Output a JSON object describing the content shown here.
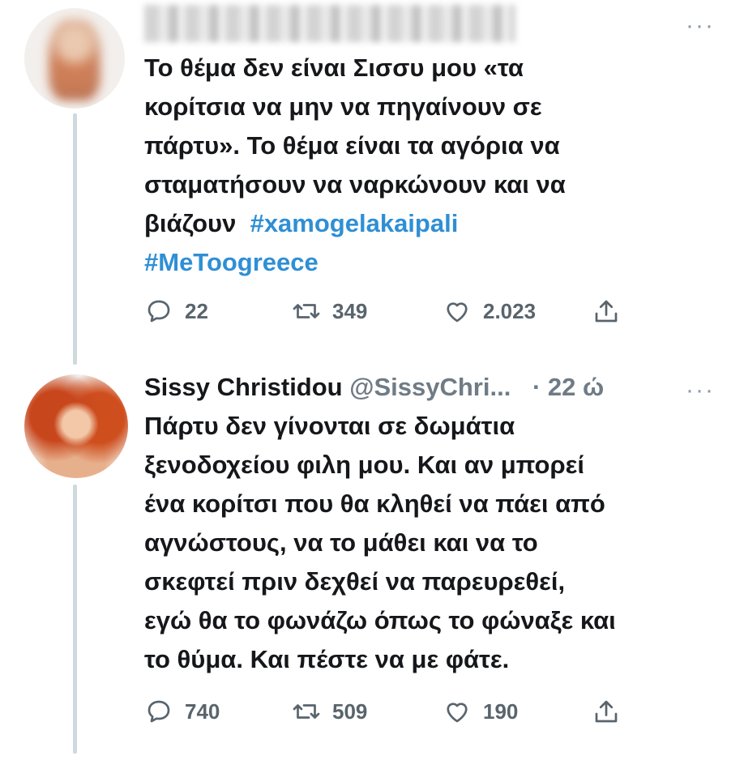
{
  "tweet1": {
    "text_lines": [
      "Το θέμα δεν είναι Σισσυ μου «τα",
      "κορίτσια να μην να πηγαίνουν σε",
      "πάρτυ». Το θέμα είναι τα αγόρια να",
      "σταματήσουν να ναρκώνουν και να",
      "βιάζουν"
    ],
    "hashtag1": "#xamogelakaipali",
    "hashtag2": "#MeToogreece",
    "more_label": "···",
    "replies": "22",
    "retweets": "349",
    "likes": "2.023"
  },
  "tweet2": {
    "display_name": "Sissy Christidou",
    "handle": "@SissyChri...",
    "time": "· 22 ώ",
    "more_label": "···",
    "text_lines": [
      "Πάρτυ δεν γίνονται σε δωμάτια",
      "ξενοδοχείου φιλη μου. Και αν μπορεί",
      "ένα κορίτσι που θα κληθεί να πάει από",
      "αγνώστους, να το μάθει και να το",
      "σκεφτεί πριν δεχθεί να παρευρεθεί,",
      "εγώ θα το φωνάζω όπως το φώναξε και",
      "το θύμα. Και πέστε να με φάτε."
    ],
    "replies": "740",
    "retweets": "509",
    "likes": "190"
  },
  "colors": {
    "hashtag": "#2f8fd5",
    "thread_line": "#cfd9de",
    "icon": "#59646d"
  },
  "icons": {
    "reply": "reply-icon",
    "retweet": "retweet-icon",
    "like": "heart-icon",
    "share": "share-icon",
    "more": "more-icon"
  }
}
